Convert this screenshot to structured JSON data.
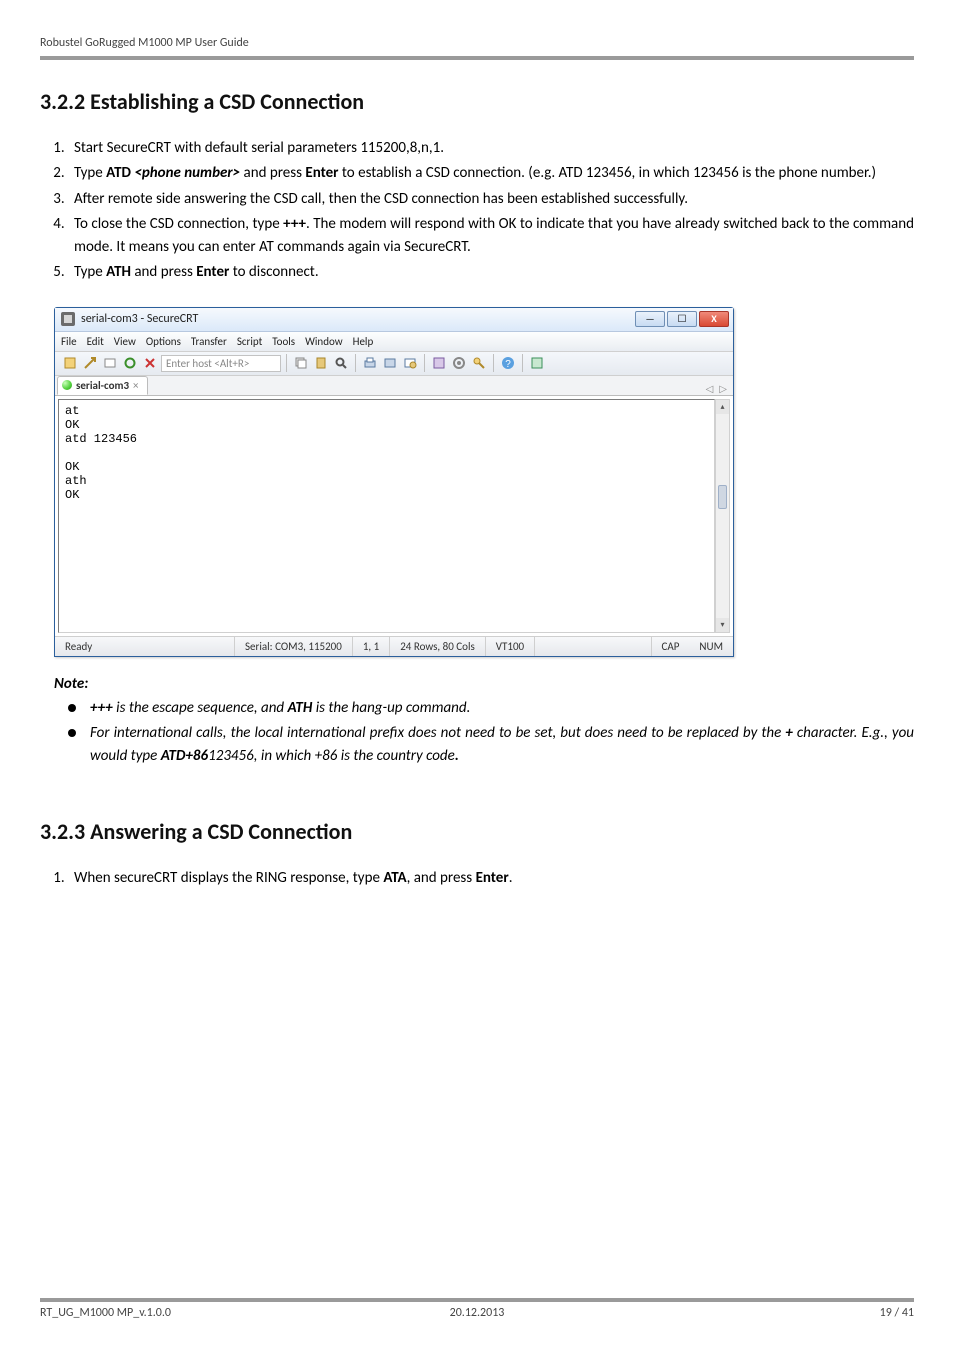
{
  "header": {
    "text": "Robustel GoRugged M1000 MP User Guide"
  },
  "section1": {
    "title": "3.2.2  Establishing a CSD Connection",
    "steps": {
      "s1": "Start SecureCRT with default serial parameters 115200,8,n,1.",
      "s2_a": "Type ",
      "s2_b_bold": "ATD ",
      "s2_c_bi": "<phone number>",
      "s2_d": " and press ",
      "s2_e_bold": "Enter",
      "s2_f": " to establish a CSD connection. (e.g. ATD 123456, in which 123456 is the phone number.)",
      "s3": "After remote side answering the CSD call, then the CSD connection has been established successfully.",
      "s4_a": "To close the CSD connection, type ",
      "s4_b_bold": "+++",
      "s4_c": ". The modem will respond with OK to indicate that you have already switched back to the command mode. It means you can enter AT commands again via SecureCRT.",
      "s5_a": "Type ",
      "s5_b_bold": "ATH",
      "s5_c": " and press ",
      "s5_d_bold": "Enter",
      "s5_e": " to disconnect."
    }
  },
  "crt": {
    "title": "serial-com3 - SecureCRT",
    "menus": {
      "file": "File",
      "edit": "Edit",
      "view": "View",
      "options": "Options",
      "transfer": "Transfer",
      "script": "Script",
      "tools": "Tools",
      "window": "Window",
      "help": "Help"
    },
    "host_placeholder": "Enter host <Alt+R>",
    "tab_label": "serial-com3",
    "tab_close": "×",
    "nav_left": "◁",
    "nav_right": "▷",
    "terminal": "at\nOK\natd 123456\n\nOK\nath\nOK",
    "status": {
      "ready": "Ready",
      "serial": "Serial: COM3, 115200",
      "pos": "1,  1",
      "size": "24 Rows, 80 Cols",
      "emu": "VT100",
      "cap": "CAP",
      "num": "NUM"
    },
    "win": {
      "min": "—",
      "max": "☐",
      "close": "X"
    }
  },
  "notes": {
    "label": "Note",
    "colon": ":",
    "n1_a": "+++",
    "n1_b": " is the escape sequence, and ",
    "n1_c": "ATH",
    "n1_d": " is the hang-up command.",
    "n2_a": "For international calls, the local international prefix does not need to be set, but does need to be replaced by the ",
    "n2_b": "+",
    "n2_c": " character. E.g., you would type ",
    "n2_d": "ATD+86",
    "n2_e": "123456, in which +86 is the country code",
    "n2_f": "."
  },
  "section2": {
    "title": "3.2.3  Answering a CSD Connection",
    "s1_a": "When secureCRT displays the RING response, type ",
    "s1_b_bold": "ATA",
    "s1_c": ", and press ",
    "s1_d_bold": "Enter",
    "s1_e": "."
  },
  "footer": {
    "left": "RT_UG_M1000 MP_v.1.0.0",
    "center": "20.12.2013",
    "right": "19 / 41"
  }
}
